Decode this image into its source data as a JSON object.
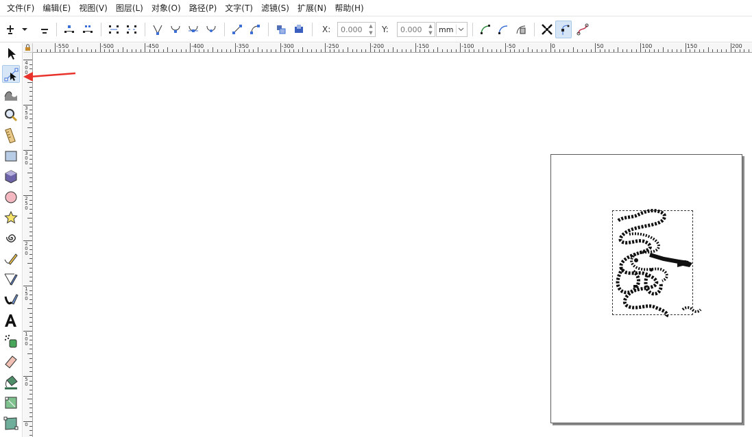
{
  "menubar": {
    "items": [
      "文件(F)",
      "编辑(E)",
      "视图(V)",
      "图层(L)",
      "对象(O)",
      "路径(P)",
      "文字(T)",
      "滤镜(S)",
      "扩展(N)",
      "帮助(H)"
    ]
  },
  "toolbar": {
    "x_label": "X:",
    "x_value": "0.000",
    "y_label": "Y:",
    "y_value": "0.000",
    "unit": "mm",
    "icons": [
      "insert-node-icon",
      "node-menu-chevron-icon",
      "delete-node-icon",
      "join-nodes-icon",
      "break-path-icon",
      "join-segment-icon",
      "delete-segment-icon",
      "cusp-node-icon",
      "smooth-node-icon",
      "symmetric-node-icon",
      "auto-smooth-node-icon",
      "segment-line-icon",
      "segment-curve-icon",
      "object-to-path-icon",
      "stroke-to-path-icon",
      "path-effect-icon",
      "clip-path-icon",
      "mask-path-icon",
      "transform-handles-icon",
      "show-handles-icon",
      "show-outline-icon"
    ]
  },
  "toolbox": {
    "active_tool": "node-tool",
    "tools": [
      "selector-tool-icon",
      "node-tool-icon",
      "tweak-tool-icon",
      "zoom-tool-icon",
      "measure-tool-icon",
      "rectangle-tool-icon",
      "3d-box-tool-icon",
      "ellipse-tool-icon",
      "star-tool-icon",
      "spiral-tool-icon",
      "pencil-tool-icon",
      "pen-tool-icon",
      "calligraphy-tool-icon",
      "text-tool-icon",
      "spray-tool-icon",
      "eraser-tool-icon",
      "paint-bucket-tool-icon",
      "gradient-tool-icon",
      "mesh-tool-icon"
    ]
  },
  "ruler": {
    "horizontal_labels": [
      "-550",
      "-500",
      "-450",
      "-400",
      "-350",
      "-300",
      "-250",
      "-200",
      "-150",
      "-100",
      "-50",
      "0",
      "50",
      "100",
      "150",
      "200"
    ],
    "vertical_labels": [
      "400",
      "350",
      "300",
      "250",
      "200",
      "150",
      "100",
      "50",
      "0"
    ]
  },
  "colors": {
    "accent": "#d7e6f6",
    "arrow": "#e8322b",
    "page_border": "#5a5a5a"
  }
}
